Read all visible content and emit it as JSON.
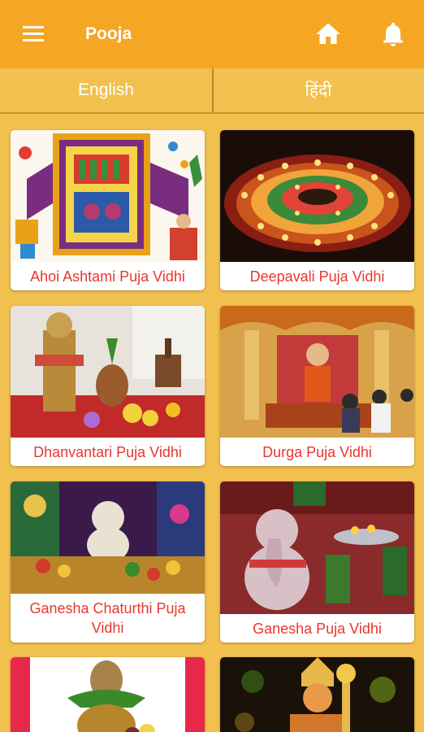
{
  "app": {
    "title": "Pooja"
  },
  "icons": {
    "menu": "hamburger-menu-icon",
    "home": "home-icon",
    "notifications": "bell-icon"
  },
  "colors": {
    "appbar": "#f5a623",
    "background": "#f2c04e",
    "label_text": "#e8372e"
  },
  "tabs": [
    {
      "label": "English"
    },
    {
      "label": "हिंदी"
    }
  ],
  "items": [
    {
      "label": "Ahoi Ashtami Puja Vidhi"
    },
    {
      "label": "Deepavali Puja Vidhi"
    },
    {
      "label": "Dhanvantari Puja Vidhi"
    },
    {
      "label": "Durga Puja Vidhi"
    },
    {
      "label": "Ganesha Chaturthi Puja Vidhi"
    },
    {
      "label": "Ganesha Puja Vidhi"
    },
    {
      "label": ""
    },
    {
      "label": ""
    }
  ]
}
